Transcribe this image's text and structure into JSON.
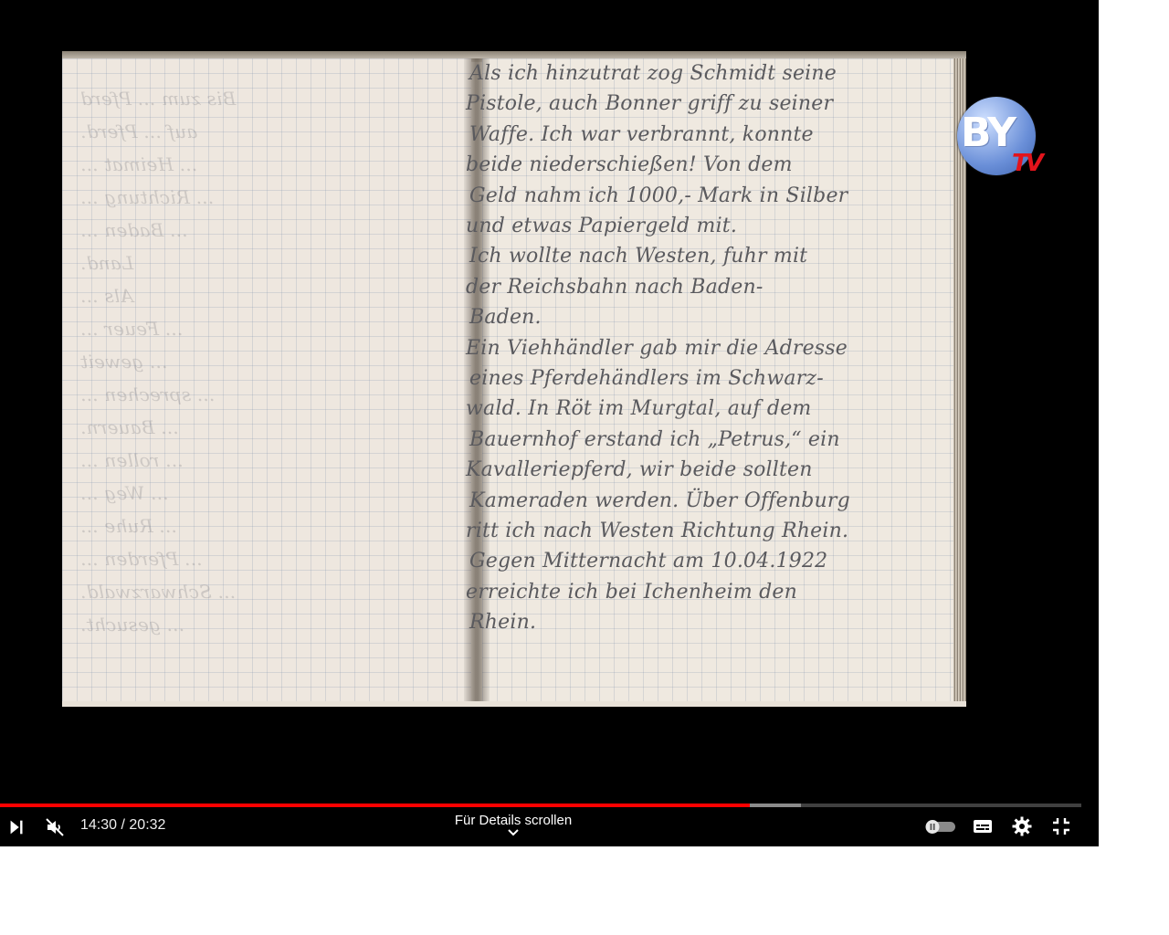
{
  "video": {
    "channel_logo": {
      "text": "BY",
      "subtext": "TV",
      "icon": "channel-logo-icon"
    },
    "notebook": {
      "right_page_lines": [
        "Als ich hinzutrat zog Schmidt seine",
        "Pistole, auch Bonner griff zu seiner",
        "Waffe. Ich war verbrannt, konnte",
        "beide niederschießen! Von dem",
        "Geld nahm ich 1000,- Mark in Silber",
        "und etwas Papiergeld mit.",
        "Ich wollte nach Westen, fuhr mit",
        "der Reichsbahn nach Baden-",
        "Baden.",
        "Ein Viehhändler gab mir die Adresse",
        "eines Pferdehändlers im Schwarz-",
        "wald. In Röt im Murgtal, auf dem",
        "Bauernhof erstand ich „Petrus,“ ein",
        "Kavalleriepferd, wir beide sollten",
        "Kameraden werden. Über Offenburg",
        "ritt ich nach Westen Richtung Rhein.",
        "Gegen Mitternacht am 10.04.1922",
        "erreichte ich bei Ichenheim den",
        "Rhein."
      ],
      "left_page_lines": [
        "Bis zum ... Pferd",
        "auf ... Pferd.",
        "... Heimat ...",
        "... Richtung ...",
        "... Baden ...",
        "Land.",
        "Als ... ",
        "... Feuer ...",
        "... geweit",
        "... sprechen ...",
        "... Bauern.",
        "... rollen ...",
        "... Weg ...",
        "... Ruhe ...",
        "... Pferden ...",
        "... Schwarzwald.",
        "... gesucht."
      ]
    }
  },
  "player": {
    "current_time": "14:30",
    "separator": "/",
    "duration": "20:32",
    "progress": 0.693,
    "buffered": 0.741,
    "scroll_hint": "Für Details scrollen",
    "colors": {
      "played": "#ff0000",
      "background": "#000000",
      "controls": "#ffffff"
    },
    "icons": {
      "play_next": "play-next-icon",
      "mute": "volume-muted-icon",
      "autoplay": "autoplay-toggle-icon",
      "subtitles": "subtitles-icon",
      "settings": "gear-icon",
      "exit_fullscreen": "exit-fullscreen-icon",
      "chevron": "chevron-down-icon"
    }
  }
}
